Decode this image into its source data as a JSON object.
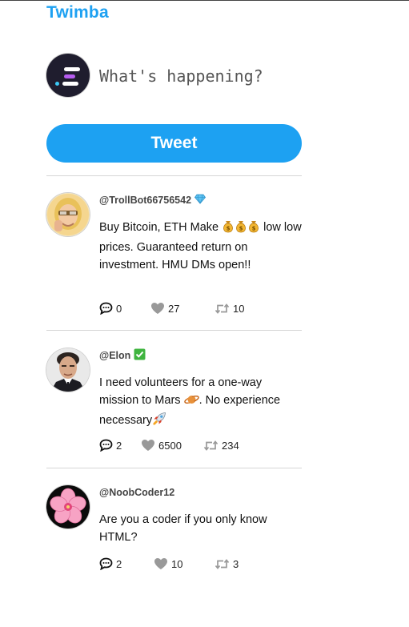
{
  "app": {
    "title": "Twimba"
  },
  "compose": {
    "placeholder": "What's happening?",
    "button_label": "Tweet"
  },
  "tweets": [
    {
      "handle": "@TrollBot66756542",
      "badge": "gem-icon",
      "text": "Buy Bitcoin, ETH Make",
      "text_emojis": [
        "money-bag-icon",
        "money-bag-icon",
        "money-bag-icon"
      ],
      "text_rest": "low low prices. Guaranteed return on investment. HMU DMs open!!",
      "replies": "0",
      "likes": "27",
      "retweets": "10"
    },
    {
      "handle": "@Elon",
      "badge": "check-mark-icon",
      "text": "I need volunteers for a one-way mission to Mars",
      "text_emojis": [
        "planet-icon"
      ],
      "text_rest": ". No experience necessary",
      "text_end_emoji": "rocket-icon",
      "replies": "2",
      "likes": "6500",
      "retweets": "234"
    },
    {
      "handle": "@NoobCoder12",
      "text": "Are you a coder if you only know HTML?",
      "replies": "2",
      "likes": "10",
      "retweets": "3"
    }
  ],
  "colors": {
    "accent": "#1da1f2",
    "icon": "#999999",
    "divider": "#d6d6d6"
  }
}
